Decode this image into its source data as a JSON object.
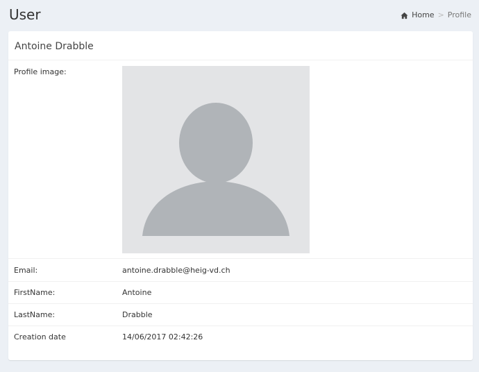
{
  "header": {
    "title": "User",
    "breadcrumb": {
      "home_label": "Home",
      "separator": ">",
      "current_label": "Profile"
    }
  },
  "profile": {
    "name": "Antoine Drabble",
    "fields": {
      "profile_image_label": "Profile image:",
      "email_label": "Email:",
      "email_value": "antoine.drabble@heig-vd.ch",
      "firstname_label": "FirstName:",
      "firstname_value": "Antoine",
      "lastname_label": "LastName:",
      "lastname_value": "Drabble",
      "creation_date_label": "Creation date",
      "creation_date_value": "14/06/2017 02:42:26"
    }
  },
  "icons": {
    "breadcrumb_home": "home-icon",
    "avatar_placeholder": "user-silhouette-icon"
  },
  "colors": {
    "page_background": "#ecf0f5",
    "box_background": "#ffffff",
    "avatar_background": "#e3e4e6",
    "avatar_figure": "#b0b4b8"
  }
}
